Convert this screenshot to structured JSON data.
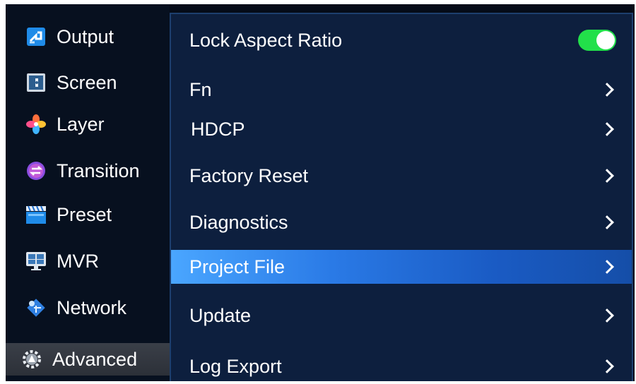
{
  "sidebar": {
    "items": [
      {
        "label": "Output",
        "icon": "output-icon"
      },
      {
        "label": "Screen",
        "icon": "screen-icon"
      },
      {
        "label": "Layer",
        "icon": "layer-icon"
      },
      {
        "label": "Transition",
        "icon": "transition-icon"
      },
      {
        "label": "Preset",
        "icon": "preset-icon"
      },
      {
        "label": "MVR",
        "icon": "mvr-icon"
      },
      {
        "label": "Network",
        "icon": "network-icon"
      },
      {
        "label": "Advanced",
        "icon": "gear-icon",
        "active": true
      }
    ]
  },
  "panel": {
    "rows": [
      {
        "label": "Lock Aspect Ratio",
        "control": "toggle",
        "value": "on"
      },
      {
        "label": "Fn",
        "control": "chevron"
      },
      {
        "label": "HDCP",
        "control": "chevron"
      },
      {
        "label": "Factory Reset",
        "control": "chevron"
      },
      {
        "label": "Diagnostics",
        "control": "chevron"
      },
      {
        "label": "Project File",
        "control": "chevron",
        "selected": true
      },
      {
        "label": "Update",
        "control": "chevron"
      },
      {
        "label": "Log Export",
        "control": "chevron"
      }
    ]
  },
  "colors": {
    "background": "#050b18",
    "panel": "#0d1f3e",
    "selected_highlight": "#2a7ae6",
    "toggle_on": "#22e04a",
    "active_sidebar": "#33373f"
  }
}
